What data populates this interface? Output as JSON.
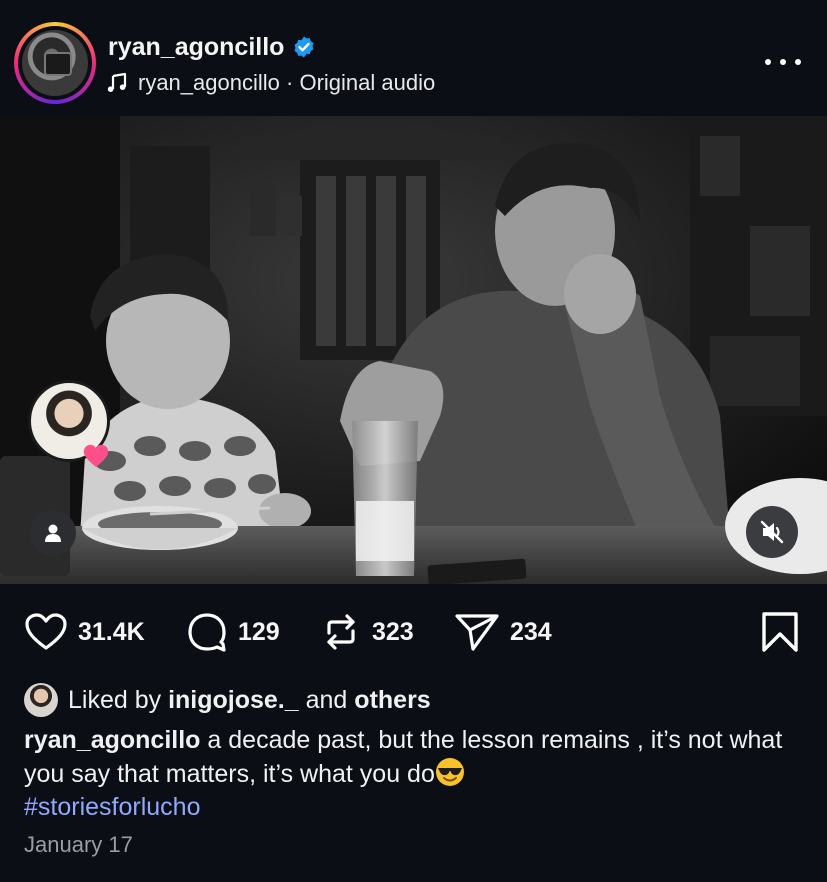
{
  "post": {
    "username": "ryan_agoncillo",
    "audio_owner": "ryan_agoncillo",
    "audio_separator": "·",
    "audio_label": "Original audio"
  },
  "icons": {
    "verified": "verified-badge-icon",
    "music": "music-note-icon",
    "more": "more-options-icon",
    "like": "heart-icon",
    "comment": "comment-bubble-icon",
    "repost": "repost-icon",
    "share": "send-icon",
    "save": "bookmark-icon",
    "tagged": "person-tag-icon",
    "mute": "speaker-muted-icon"
  },
  "counts": {
    "likes": "31.4K",
    "comments": "129",
    "reposts": "323",
    "shares": "234"
  },
  "liked_by": {
    "prefix": "Liked by",
    "user": "inigojose._",
    "joiner": "and",
    "others": "others"
  },
  "caption": {
    "username": "ryan_agoncillo",
    "text": "a decade past, but the lesson remains , it’s not what you say that matters, it’s what you do",
    "emoji": "smiling-face-with-sunglasses-emoji",
    "hashtag": "#storiesforlucho"
  },
  "date": "January 17",
  "colors": {
    "background": "#0b0e14",
    "verified_blue": "#1d9bf0",
    "hashtag_blue": "#8fa9ff",
    "secondary_text": "#9a9ca3",
    "like_heart_pink": "#ff4f8b"
  }
}
